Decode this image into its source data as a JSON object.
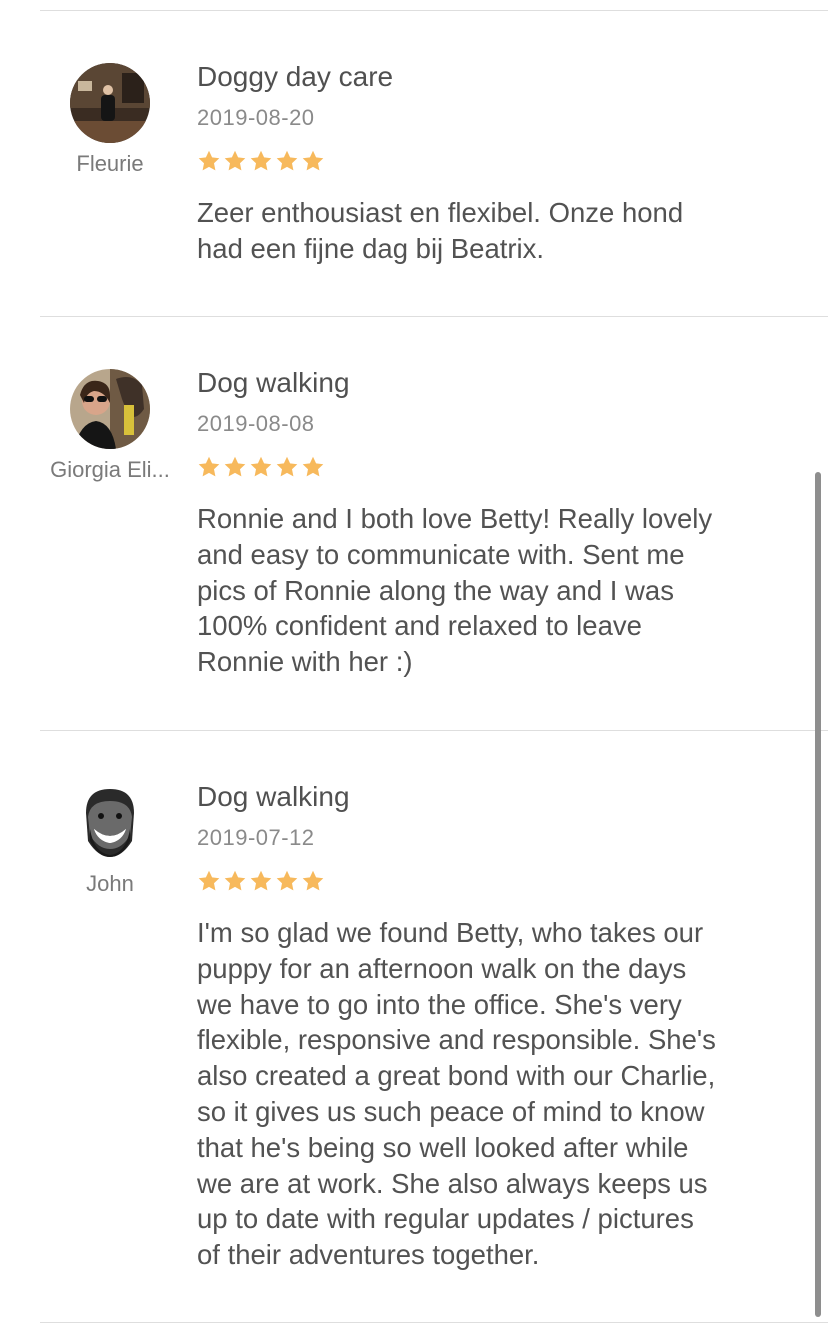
{
  "reviews": [
    {
      "reviewer": "Fleurie",
      "service": "Doggy day care",
      "date": "2019-08-20",
      "rating": 5,
      "comment_lines": [
        "Zeer enthousiast en flexibel. Onze hond",
        "had een fijne dag bij Beatrix."
      ]
    },
    {
      "reviewer": "Giorgia Eli...",
      "service": "Dog walking",
      "date": "2019-08-08",
      "rating": 5,
      "comment_lines": [
        "Ronnie and I both love Betty! Really lovely",
        "and easy to communicate with. Sent me",
        "pics of Ronnie along the way and I was",
        "100% confident and relaxed to leave",
        "Ronnie with her :)"
      ]
    },
    {
      "reviewer": "John",
      "service": "Dog walking",
      "date": "2019-07-12",
      "rating": 5,
      "comment_lines": [
        "I'm so glad we found Betty, who takes our",
        "puppy for an afternoon walk on the days",
        "we have to go into the office. She's very",
        "flexible, responsive and responsible. She's",
        "also created a great bond with our Charlie,",
        "so it gives us such peace of mind to know",
        "that he's being so well looked after while",
        "we are at work. She also always keeps us",
        "up to date with regular updates / pictures",
        "of their adventures together."
      ]
    }
  ],
  "colors": {
    "star": "#f7b95c",
    "divider": "#dedede",
    "text": "#525252",
    "muted": "#8a8a8a"
  },
  "icons": {
    "star": "star-icon"
  }
}
